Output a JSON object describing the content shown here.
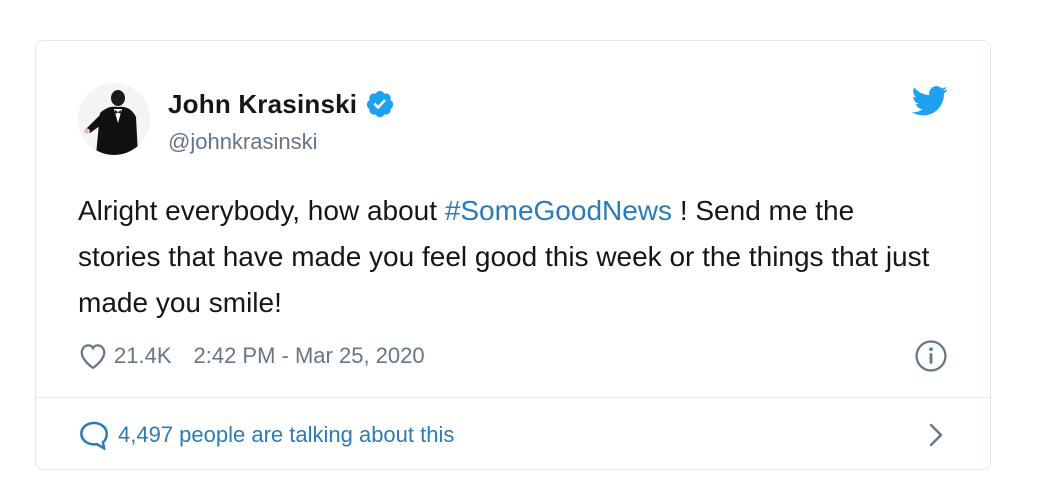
{
  "author": {
    "name": "John Krasinski",
    "handle": "@johnkrasinski",
    "verified": true
  },
  "tweet": {
    "text_before": "Alright everybody, how about ",
    "hashtag": "#SomeGoodNews",
    "text_after": " !  Send me the stories that have made you feel good this week or the things that just made you smile!"
  },
  "meta": {
    "likes": "21.4K",
    "timestamp": "2:42 PM - Mar 25, 2020"
  },
  "conversation": {
    "label": "4,497 people are talking about this"
  },
  "icons": {
    "like": "heart-icon",
    "info": "info-icon",
    "conversation": "speech-bubble-icon",
    "expand": "chevron-right-icon",
    "brand": "twitter-bird-icon",
    "verified": "verified-badge-icon"
  },
  "colors": {
    "brand_blue": "#1da1f2",
    "link_blue": "#2b7bb9",
    "text_primary": "#14171a",
    "text_secondary": "#657786",
    "border": "#e1e8ed"
  }
}
